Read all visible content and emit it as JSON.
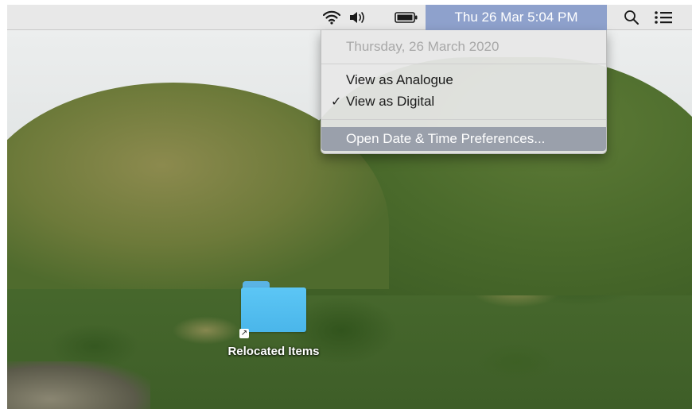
{
  "menubar": {
    "icons": [
      "wifi-icon",
      "volume-icon",
      "battery-icon",
      "spotlight-search-icon",
      "notification-center-icon"
    ],
    "clock_label": "Thu 26 Mar  5:04 PM",
    "clock_highlight_color": "#8ea1cc"
  },
  "clock_menu": {
    "date_header": "Thursday, 26 March 2020",
    "items": [
      {
        "label": "View as Analogue",
        "checked": false
      },
      {
        "label": "View as Digital",
        "checked": true
      }
    ],
    "checkmark": "✓",
    "preferences_label": "Open Date & Time Preferences...",
    "highlight_color": "#9aa0ab"
  },
  "desktop": {
    "folder_label": "Relocated Items",
    "folder_color": "#4ab6ea",
    "alias_arrow": "↗"
  }
}
